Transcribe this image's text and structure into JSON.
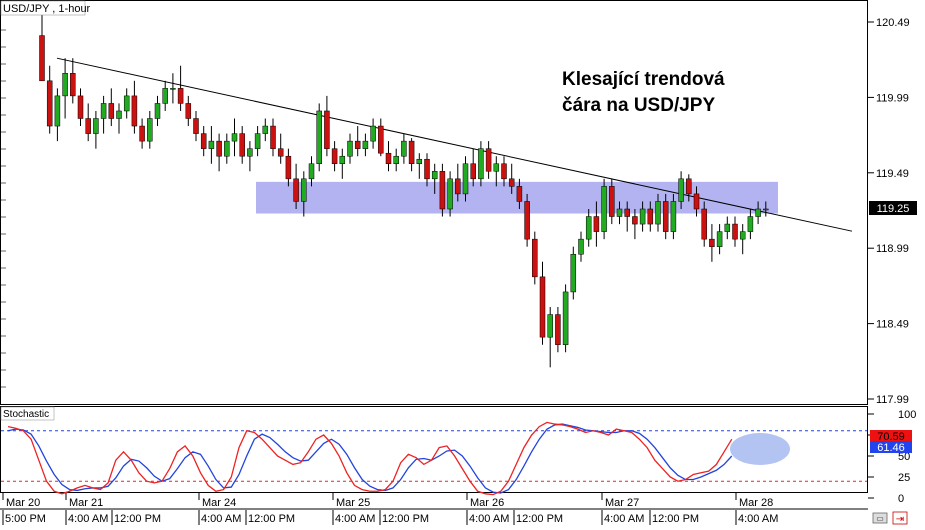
{
  "header": {
    "symbol_label": "USD/JPY , 1-hour"
  },
  "annotation": {
    "line1": "Klesající trendová",
    "line2": "čára na USD/JPY"
  },
  "price_axis": {
    "ticks": [
      120.49,
      119.99,
      119.49,
      118.99,
      118.49,
      117.99
    ],
    "tick_labels": [
      "120.49",
      "119.99",
      "119.49",
      "118.99",
      "118.49",
      "117.99"
    ],
    "current_price": "119.25"
  },
  "stochastic": {
    "label": "Stochastic",
    "tick_labels": [
      "100",
      "75",
      "50",
      "25",
      "0"
    ],
    "ticks": [
      100,
      75,
      50,
      25,
      0
    ],
    "value_k": "70.59",
    "value_d": "61.46",
    "overbought": 80,
    "oversold": 20
  },
  "time_axis": {
    "dates": [
      "Mar 20",
      "Mar 21",
      "Mar 24",
      "Mar 25",
      "Mar 26",
      "Mar 27",
      "Mar 28"
    ],
    "times": [
      "5:00 PM",
      "4:00 AM",
      "12:00 PM",
      "4:00 AM",
      "12:00 PM",
      "4:00 AM",
      "12:00 PM",
      "4:00 AM",
      "12:00 PM",
      "4:00 AM",
      "12:00 PM",
      "4:00 AM"
    ]
  },
  "colors": {
    "bull": "#22aa22",
    "bear": "#cc1111",
    "zone": "#9999ee",
    "k_line": "#ee2222",
    "d_line": "#2244dd"
  },
  "chart_data": {
    "type": "candlestick",
    "title": "USD/JPY , 1-hour",
    "ylim": [
      117.9,
      120.6
    ],
    "ohlc": [
      [
        120.4,
        120.6,
        120.1,
        120.1
      ],
      [
        120.1,
        120.2,
        119.75,
        119.8
      ],
      [
        119.8,
        120.05,
        119.7,
        120.0
      ],
      [
        120.0,
        120.25,
        119.85,
        120.15
      ],
      [
        120.15,
        120.25,
        119.95,
        120.0
      ],
      [
        120.0,
        120.05,
        119.8,
        119.85
      ],
      [
        119.85,
        119.95,
        119.7,
        119.75
      ],
      [
        119.75,
        119.9,
        119.65,
        119.85
      ],
      [
        119.85,
        120.0,
        119.75,
        119.95
      ],
      [
        119.95,
        120.05,
        119.8,
        119.85
      ],
      [
        119.85,
        119.95,
        119.75,
        119.9
      ],
      [
        119.9,
        120.05,
        119.85,
        120.0
      ],
      [
        120.0,
        120.1,
        119.75,
        119.8
      ],
      [
        119.8,
        119.85,
        119.65,
        119.7
      ],
      [
        119.7,
        119.9,
        119.65,
        119.85
      ],
      [
        119.85,
        120.0,
        119.8,
        119.95
      ],
      [
        119.95,
        120.1,
        119.9,
        120.05
      ],
      [
        120.05,
        120.15,
        119.95,
        120.05
      ],
      [
        120.05,
        120.2,
        119.9,
        119.95
      ],
      [
        119.95,
        120.0,
        119.8,
        119.85
      ],
      [
        119.85,
        119.9,
        119.7,
        119.75
      ],
      [
        119.75,
        119.8,
        119.6,
        119.65
      ],
      [
        119.65,
        119.8,
        119.55,
        119.7
      ],
      [
        119.7,
        119.75,
        119.5,
        119.6
      ],
      [
        119.6,
        119.75,
        119.55,
        119.7
      ],
      [
        119.7,
        119.85,
        119.6,
        119.75
      ],
      [
        119.75,
        119.8,
        119.55,
        119.6
      ],
      [
        119.6,
        119.7,
        119.5,
        119.65
      ],
      [
        119.65,
        119.8,
        119.6,
        119.75
      ],
      [
        119.75,
        119.85,
        119.7,
        119.8
      ],
      [
        119.8,
        119.85,
        119.6,
        119.65
      ],
      [
        119.65,
        119.75,
        119.55,
        119.6
      ],
      [
        119.6,
        119.65,
        119.4,
        119.45
      ],
      [
        119.45,
        119.55,
        119.25,
        119.3
      ],
      [
        119.3,
        119.5,
        119.2,
        119.45
      ],
      [
        119.45,
        119.6,
        119.4,
        119.55
      ],
      [
        119.55,
        119.95,
        119.5,
        119.9
      ],
      [
        119.9,
        120.0,
        119.6,
        119.65
      ],
      [
        119.65,
        119.7,
        119.5,
        119.55
      ],
      [
        119.55,
        119.65,
        119.45,
        119.6
      ],
      [
        119.6,
        119.75,
        119.55,
        119.7
      ],
      [
        119.7,
        119.8,
        119.6,
        119.65
      ],
      [
        119.65,
        119.75,
        119.6,
        119.7
      ],
      [
        119.7,
        119.85,
        119.65,
        119.8
      ],
      [
        119.8,
        119.85,
        119.6,
        119.62
      ],
      [
        119.62,
        119.7,
        119.5,
        119.55
      ],
      [
        119.55,
        119.65,
        119.5,
        119.6
      ],
      [
        119.6,
        119.75,
        119.55,
        119.7
      ],
      [
        119.7,
        119.72,
        119.5,
        119.55
      ],
      [
        119.55,
        119.62,
        119.45,
        119.58
      ],
      [
        119.58,
        119.62,
        119.4,
        119.45
      ],
      [
        119.45,
        119.55,
        119.35,
        119.5
      ],
      [
        119.5,
        119.55,
        119.2,
        119.25
      ],
      [
        119.25,
        119.5,
        119.2,
        119.45
      ],
      [
        119.45,
        119.55,
        119.3,
        119.35
      ],
      [
        119.35,
        119.6,
        119.3,
        119.55
      ],
      [
        119.55,
        119.65,
        119.4,
        119.45
      ],
      [
        119.45,
        119.7,
        119.4,
        119.65
      ],
      [
        119.65,
        119.7,
        119.45,
        119.5
      ],
      [
        119.5,
        119.6,
        119.4,
        119.55
      ],
      [
        119.55,
        119.6,
        119.4,
        119.45
      ],
      [
        119.45,
        119.55,
        119.35,
        119.4
      ],
      [
        119.4,
        119.45,
        119.25,
        119.3
      ],
      [
        119.3,
        119.35,
        119.0,
        119.05
      ],
      [
        119.05,
        119.1,
        118.75,
        118.8
      ],
      [
        118.8,
        118.9,
        118.35,
        118.4
      ],
      [
        118.4,
        118.6,
        118.2,
        118.55
      ],
      [
        118.55,
        118.6,
        118.3,
        118.35
      ],
      [
        118.35,
        118.75,
        118.3,
        118.7
      ],
      [
        118.7,
        119.0,
        118.65,
        118.95
      ],
      [
        118.95,
        119.1,
        118.9,
        119.05
      ],
      [
        119.05,
        119.25,
        119.0,
        119.2
      ],
      [
        119.2,
        119.3,
        119.0,
        119.1
      ],
      [
        119.1,
        119.45,
        119.05,
        119.4
      ],
      [
        119.4,
        119.45,
        119.15,
        119.2
      ],
      [
        119.2,
        119.3,
        119.15,
        119.25
      ],
      [
        119.25,
        119.3,
        119.1,
        119.2
      ],
      [
        119.2,
        119.25,
        119.05,
        119.15
      ],
      [
        119.15,
        119.3,
        119.1,
        119.25
      ],
      [
        119.25,
        119.3,
        119.1,
        119.15
      ],
      [
        119.15,
        119.35,
        119.1,
        119.3
      ],
      [
        119.3,
        119.35,
        119.05,
        119.1
      ],
      [
        119.1,
        119.35,
        119.05,
        119.3
      ],
      [
        119.3,
        119.5,
        119.25,
        119.45
      ],
      [
        119.45,
        119.48,
        119.3,
        119.35
      ],
      [
        119.35,
        119.4,
        119.2,
        119.25
      ],
      [
        119.25,
        119.3,
        119.0,
        119.05
      ],
      [
        119.05,
        119.15,
        118.9,
        119.0
      ],
      [
        119.0,
        119.15,
        118.95,
        119.1
      ],
      [
        119.1,
        119.2,
        119.05,
        119.15
      ],
      [
        119.15,
        119.2,
        119.0,
        119.05
      ],
      [
        119.05,
        119.15,
        118.95,
        119.1
      ],
      [
        119.1,
        119.25,
        119.05,
        119.2
      ],
      [
        119.2,
        119.3,
        119.15,
        119.25
      ],
      [
        119.25,
        119.3,
        119.2,
        119.25
      ]
    ],
    "trendline": [
      [
        0,
        120.25
      ],
      [
        108,
        119.05
      ]
    ],
    "zone": [
      119.22,
      119.43
    ],
    "stoch_k": [
      85,
      83,
      80,
      70,
      45,
      20,
      8,
      5,
      8,
      12,
      15,
      12,
      10,
      18,
      45,
      55,
      45,
      30,
      20,
      18,
      20,
      35,
      55,
      62,
      50,
      30,
      15,
      8,
      10,
      25,
      60,
      80,
      78,
      70,
      60,
      50,
      45,
      40,
      42,
      55,
      70,
      75,
      65,
      50,
      30,
      15,
      10,
      8,
      8,
      10,
      20,
      42,
      52,
      48,
      40,
      45,
      60,
      62,
      50,
      35,
      20,
      8,
      5,
      4,
      8,
      20,
      40,
      60,
      75,
      85,
      90,
      88,
      87,
      85,
      82,
      78,
      80,
      78,
      75,
      82,
      80,
      78,
      70,
      60,
      45,
      35,
      25,
      20,
      22,
      28,
      30,
      32,
      40,
      55,
      70
    ],
    "stoch_d": [
      80,
      82,
      81,
      76,
      62,
      44,
      28,
      16,
      10,
      9,
      11,
      12,
      12,
      14,
      24,
      38,
      46,
      44,
      36,
      26,
      20,
      23,
      35,
      48,
      55,
      52,
      38,
      22,
      12,
      13,
      28,
      50,
      70,
      76,
      72,
      64,
      55,
      48,
      44,
      45,
      55,
      65,
      70,
      64,
      52,
      36,
      22,
      14,
      10,
      9,
      12,
      22,
      36,
      46,
      47,
      45,
      50,
      56,
      57,
      50,
      38,
      24,
      12,
      7,
      6,
      10,
      22,
      38,
      55,
      70,
      82,
      87,
      88,
      86,
      84,
      81,
      80,
      79,
      78,
      78,
      80,
      80,
      77,
      70,
      60,
      48,
      36,
      27,
      22,
      22,
      25,
      29,
      33,
      40,
      50
    ]
  }
}
